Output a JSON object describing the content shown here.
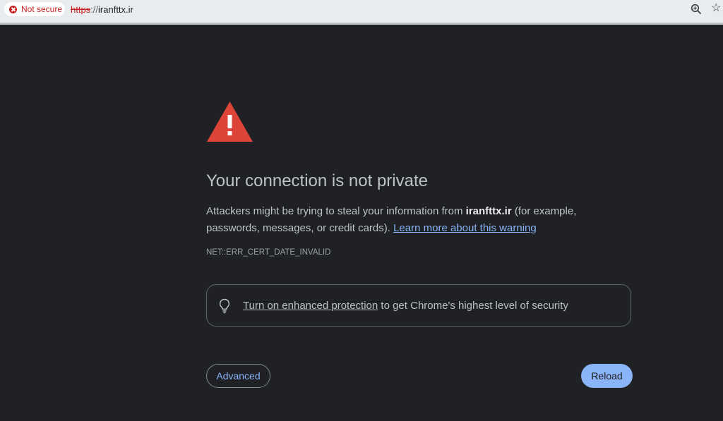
{
  "address_bar": {
    "security_chip": "Not secure",
    "url_scheme": "https",
    "url_separator": "://",
    "url_host": "iranfttx.ir",
    "zoom_icon": "zoom-in-icon",
    "bookmark_icon": "star-icon"
  },
  "interstitial": {
    "icon": "warning-triangle-icon",
    "title": "Your connection is not private",
    "body_before": "Attackers might be trying to steal your information from ",
    "body_host": "iranfttx.ir",
    "body_after": " (for example, passwords, messages, or credit cards). ",
    "learn_more": "Learn more about this warning",
    "error_code": "NET::ERR_CERT_DATE_INVALID",
    "enhanced": {
      "icon": "lightbulb-icon",
      "link": "Turn on enhanced protection",
      "rest": " to get Chrome's highest level of security"
    },
    "advanced_button": "Advanced",
    "reload_button": "Reload"
  },
  "colors": {
    "background": "#202124",
    "accent": "#8ab4f8",
    "warning": "#db4437",
    "insecure": "#c5221f"
  }
}
